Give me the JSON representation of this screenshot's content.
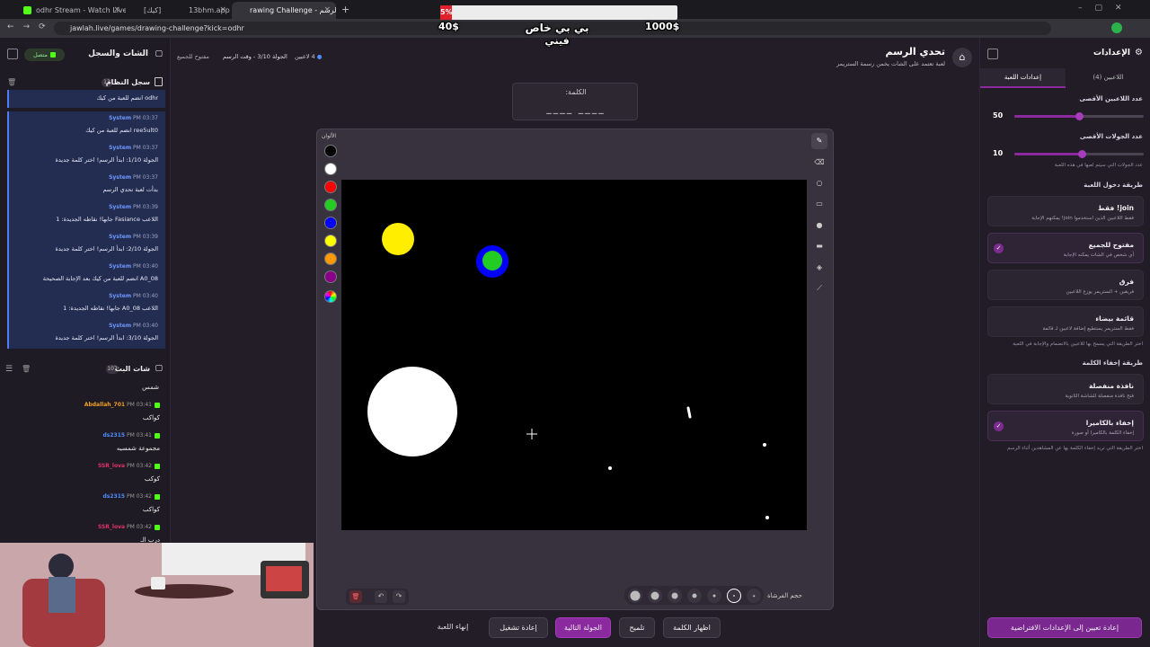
{
  "browser": {
    "tabs": [
      {
        "label": "odhr Stream - Watch Live on Ki"
      },
      {
        "label": "[كيك]"
      },
      {
        "label": "13bhm.app | لعبة"
      },
      {
        "label": "rawing Challenge - تحدي الرسم"
      }
    ],
    "url": "jawlah.live/games/drawing-challenge?kick=odhr"
  },
  "overlay": {
    "percent": "5%",
    "left_amount": "40$",
    "right_amount": "1000$",
    "caption_line1": "بي بي خاص",
    "caption_line2": "فيني"
  },
  "left_panel": {
    "title": "الشات والسجل",
    "status": "متصل",
    "system_log_title": "سجل النظام",
    "system_log_count": "13",
    "system_top_msg": "odhr انضم للعبة من كيك",
    "system_entries": [
      {
        "name": "System",
        "time": "PM 03:37",
        "text": "ree5ult0 انضم للعبة من كيك"
      },
      {
        "name": "System",
        "time": "PM 03:37",
        "text": "الجولة 1/10: ابدأ الرسم! اختر كلمة جديدة"
      },
      {
        "name": "System",
        "time": "PM 03:37",
        "text": "بدأت لعبة تحدي الرسم"
      },
      {
        "name": "System",
        "time": "PM 03:39",
        "text": "اللاعب Fasiance جابها! نقاطه الجديدة: 1"
      },
      {
        "name": "System",
        "time": "PM 03:39",
        "text": "الجولة 2/10: ابدأ الرسم! اختر كلمة جديدة"
      },
      {
        "name": "System",
        "time": "PM 03:40",
        "text": "A0_08 انضم للعبة من كيك بعد الإجابة الصحيحة"
      },
      {
        "name": "System",
        "time": "PM 03:40",
        "text": "اللاعب A0_08 جابها! نقاطه الجديدة: 1"
      },
      {
        "name": "System",
        "time": "PM 03:40",
        "text": "الجولة 3/10: ابدأ الرسم! اختر كلمة جديدة"
      }
    ],
    "chat_title": "شات البث",
    "chat_count": "107",
    "chat_top_msg": "شمس",
    "chat_entries": [
      {
        "name": "Abdallah_701",
        "time": "PM 03:41",
        "text": "كواكب",
        "color": "#f0a020"
      },
      {
        "name": "ds2315",
        "time": "PM 03:41",
        "text": "مجموعة شمسيه",
        "color": "#4f8cff"
      },
      {
        "name": "SSR_lova",
        "time": "PM 03:42",
        "text": "كوكب",
        "color": "#e0306a"
      },
      {
        "name": "ds2315",
        "time": "PM 03:42",
        "text": "كواكب",
        "color": "#4f8cff"
      },
      {
        "name": "SSR_lova",
        "time": "PM 03:42",
        "text": "درب الـ",
        "color": "#e0306a"
      }
    ]
  },
  "header": {
    "title": "تحدي الرسم",
    "subtitle": "لعبة تعتمد على الشات يخمن رسمة الستريمر",
    "players": "4 لاعبين",
    "round_info": "الجولة 3/10 - وقت الرسم",
    "mode": "مفتوح للجميع"
  },
  "word": {
    "label": "الكلمة:",
    "blanks": "____ ____"
  },
  "board": {
    "colors_label": "الألوان",
    "brush_size_label": "حجم الفرشاة",
    "colors": [
      "#000000",
      "#ffffff",
      "#ff0000",
      "#22cc22",
      "#0000ff",
      "#ffff00",
      "#ff9900",
      "#880088"
    ]
  },
  "actions": {
    "end_game": "إنهاء اللعبة",
    "restart": "إعادة تشغيل",
    "next_round": "الجولة التالية",
    "hint": "تلميح",
    "show_word": "اظهار الكلمة"
  },
  "settings": {
    "title": "الإعدادات",
    "tab_players": "اللاعبين (4)",
    "tab_game": "إعدادات اللعبة",
    "max_players_label": "عدد اللاعبين الأقصى",
    "max_players_value": "50",
    "max_players_fill": 0.5,
    "max_rounds_label": "عدد الجولات الأقصى",
    "max_rounds_value": "10",
    "max_rounds_fill": 0.52,
    "max_rounds_hint": "عدد الجولات التي سيتم لعبها في هذه اللعبة",
    "join_method_title": "طريقة دخول اللعبة",
    "join_options": [
      {
        "title": "join! فقط",
        "desc": "فقط اللاعبين الذين استخدموا join! يمكنهم الإجابة",
        "checked": false
      },
      {
        "title": "مفتوح للجميع",
        "desc": "أي شخص في الشات يمكنه الإجابة",
        "checked": true
      },
      {
        "title": "فرق",
        "desc": "فريقين + الستريمر يوزع اللاعبين",
        "checked": false
      },
      {
        "title": "قائمة بيضاء",
        "desc": "فقط الستريمر يستطيع إضافة لاعبين لـ قائمة",
        "checked": false
      }
    ],
    "join_hint": "اختر الطريقة التي يسمح بها للاعبين بالانضمام والإجابة في اللعبة",
    "hide_method_title": "طريقة إخفاء الكلمة",
    "hide_options": [
      {
        "title": "نافذة منفصلة",
        "desc": "فتح نافذة منفصلة للشاشة الثانوية",
        "checked": false
      },
      {
        "title": "إخفاء بالكاميرا",
        "desc": "إخفاء الكلمة بالكاميرا أو صورة",
        "checked": true
      }
    ],
    "hide_hint": "اختر الطريقة التي تريد إخفاء الكلمة بها عن المشاهدين أثناء الرسم",
    "reset_button": "إعادة تعيين إلى الإعدادات الافتراضية"
  }
}
